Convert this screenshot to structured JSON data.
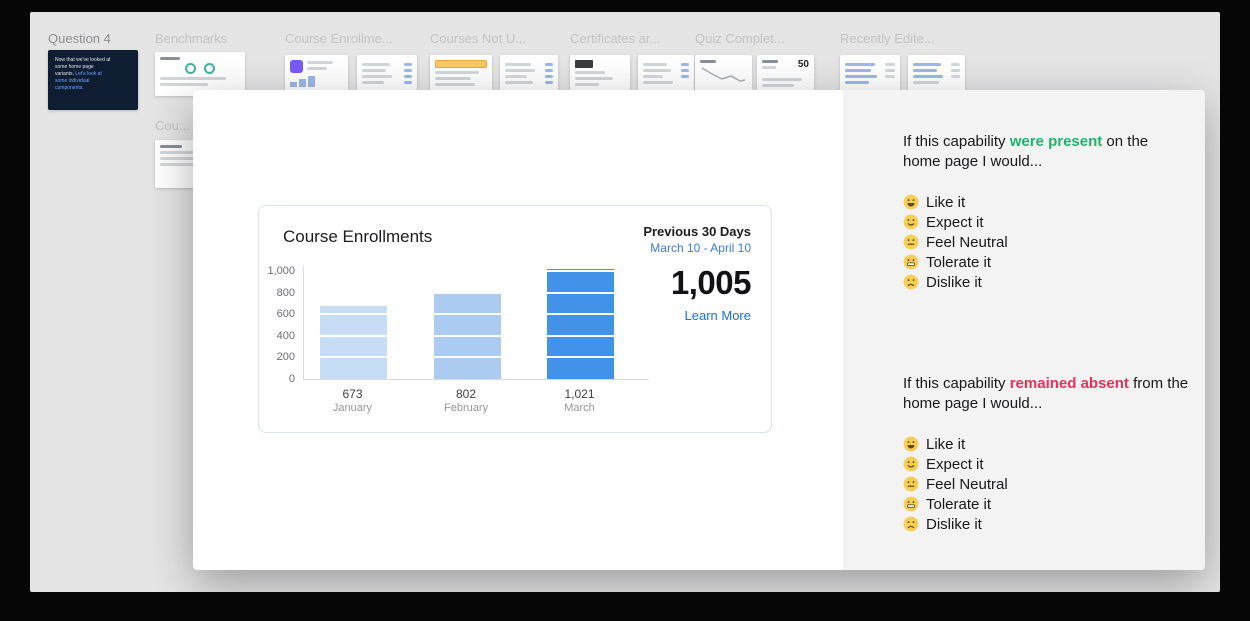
{
  "filmstrip": {
    "sections": [
      {
        "id": "question-4",
        "title": "Question 4"
      },
      {
        "id": "benchmarks",
        "title": "Benchmarks"
      },
      {
        "id": "course-enrollments",
        "title": "Course Enrollme..."
      },
      {
        "id": "courses-not-used",
        "title": "Courses Not U..."
      },
      {
        "id": "certificates",
        "title": "Certificates ar..."
      },
      {
        "id": "quiz-completions",
        "title": "Quiz Complet..."
      },
      {
        "id": "recently-edited",
        "title": "Recently Edite..."
      }
    ],
    "partial_section_title": "Cou...",
    "question4_thumb": {
      "line1": "Now that we've looked at some home page variants.",
      "line2": "Let's look at some individual components."
    },
    "quiz_thumb_value": "50"
  },
  "modal": {
    "stat_card": {
      "title": "Course Enrollments",
      "period_label": "Previous 30 Days",
      "period_range": "March 10 - April 10",
      "total": "1,005",
      "link_label": "Learn More",
      "link_color": "#1a6fe3"
    },
    "survey": {
      "present": {
        "prefix": "If this capability ",
        "highlight": "were present",
        "suffix": " on the home page I would...",
        "highlight_color": "#1fb36e"
      },
      "absent": {
        "prefix": "If this capability ",
        "highlight": "remained absent",
        "suffix": " from the home page I would...",
        "highlight_color": "#e9315a"
      },
      "options": [
        {
          "icon": "grin-face-icon",
          "label": "Like it"
        },
        {
          "icon": "smile-face-icon",
          "label": "Expect it"
        },
        {
          "icon": "neutral-face-icon",
          "label": "Feel Neutral"
        },
        {
          "icon": "grimace-face-icon",
          "label": "Tolerate it"
        },
        {
          "icon": "frown-face-icon",
          "label": "Dislike it"
        }
      ]
    }
  },
  "chart_data": {
    "type": "bar",
    "title": "Course Enrollments",
    "categories": [
      "January",
      "February",
      "March"
    ],
    "values": [
      673,
      802,
      1021
    ],
    "value_labels": [
      "673",
      "802",
      "1,021"
    ],
    "xlabel": "",
    "ylabel": "",
    "ylim": [
      0,
      1000
    ],
    "yticks": [
      0,
      200,
      400,
      600,
      800,
      1000
    ],
    "ytick_labels": [
      "0",
      "200",
      "400",
      "600",
      "800",
      "1,000"
    ],
    "bar_colors": [
      "#c7ddf5",
      "#abccf0",
      "#4392e9"
    ],
    "grid": true,
    "legend": false
  }
}
